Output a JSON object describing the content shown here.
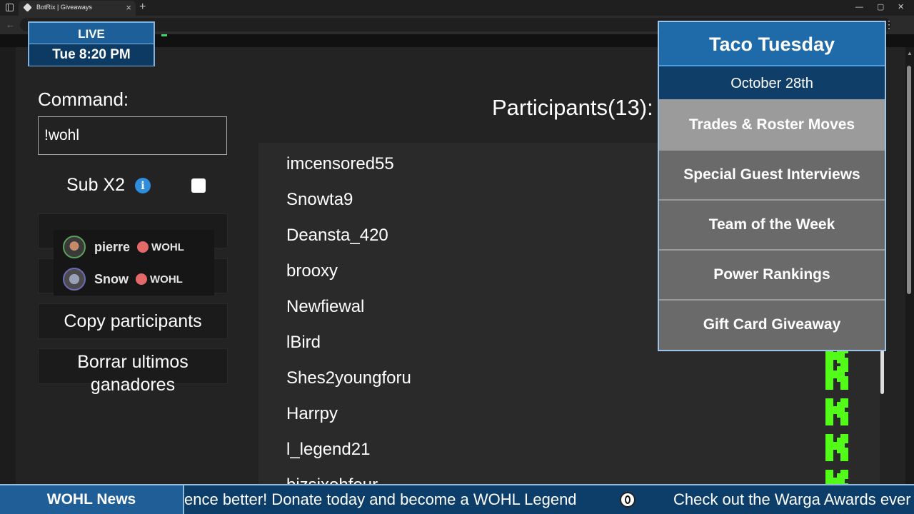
{
  "browser": {
    "tab_title": "BotRix | Giveaways",
    "tab_close": "×",
    "new_tab": "+",
    "back": "←",
    "menu": "⋮",
    "minimize": "—",
    "restore": "▢",
    "close": "✕"
  },
  "form": {
    "command_label": "Command:",
    "command_value": "!wohl",
    "sub_label": "Sub X2",
    "info_glyph": "i",
    "sub_checked": false,
    "copy_button": "Copy participants",
    "borrar_button": "Borrar ultimos ganadores"
  },
  "chat_overlay": [
    {
      "name": "pierre",
      "tag": "WOHL"
    },
    {
      "name": "Snow",
      "tag": "WOHL"
    }
  ],
  "participants": {
    "title": "Participants(13):",
    "names": [
      "imcensored55",
      "Snowta9",
      "Deansta_420",
      "brooxy",
      "Newfiewal",
      "lBird",
      "Shes2youngforu",
      "Harrpy",
      "l_legend21",
      "bizsixohfour"
    ]
  },
  "live_box": {
    "status": "LIVE",
    "time": "Tue 8:20 PM"
  },
  "taco_panel": {
    "title": "Taco Tuesday",
    "date": "October 28th",
    "segments": [
      "Trades & Roster Moves",
      "Special Guest Interviews",
      "Team of the Week",
      "Power Rankings",
      "Gift Card Giveaway"
    ],
    "active_index": 0
  },
  "ticker": {
    "label": "WOHL News",
    "text_1": "ence better! Donate today and become a WOHL Legend",
    "text_2": "Check out the Warga Awards ever"
  },
  "colors": {
    "kick_green": "#53fc18",
    "panel_blue": "#1f6aa8"
  }
}
